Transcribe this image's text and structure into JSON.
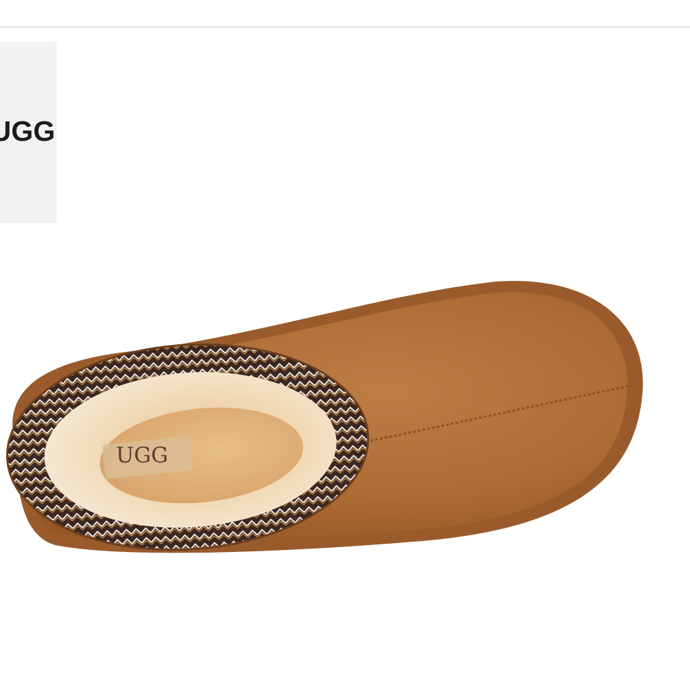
{
  "brand_card": {
    "text": "UGG"
  },
  "product": {
    "image_subject": "chestnut-suede-slipper",
    "insole_logo": "UGG",
    "colors": {
      "suede": "#b06f38",
      "suede_dark": "#8a5226",
      "shearling": "#f0dcc0",
      "trim_dark": "#3b2721"
    }
  }
}
